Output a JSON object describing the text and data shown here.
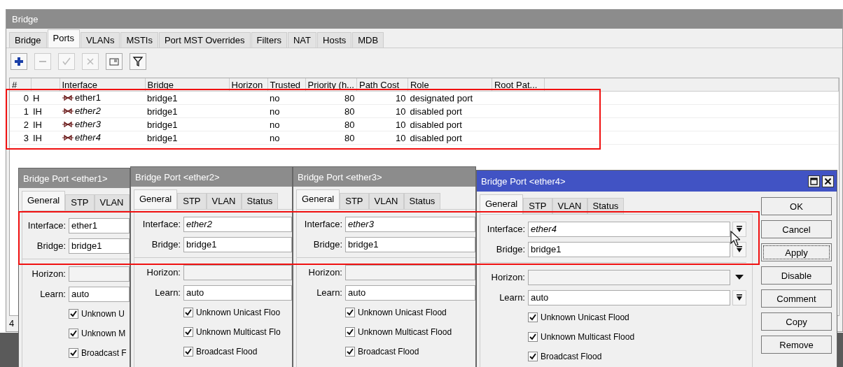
{
  "window": {
    "title": "Bridge"
  },
  "tabs": [
    {
      "label": "Bridge",
      "selected": false
    },
    {
      "label": "Ports",
      "selected": true
    },
    {
      "label": "VLANs",
      "selected": false
    },
    {
      "label": "MSTIs",
      "selected": false
    },
    {
      "label": "Port MST Overrides",
      "selected": false
    },
    {
      "label": "Filters",
      "selected": false
    },
    {
      "label": "NAT",
      "selected": false
    },
    {
      "label": "Hosts",
      "selected": false
    },
    {
      "label": "MDB",
      "selected": false
    }
  ],
  "toolbar": [
    {
      "kind": "add",
      "disabled": false
    },
    {
      "kind": "remove",
      "disabled": true
    },
    {
      "kind": "enable",
      "disabled": true
    },
    {
      "kind": "disable",
      "disabled": true
    },
    {
      "kind": "comment",
      "disabled": false
    },
    {
      "kind": "filter",
      "disabled": false
    }
  ],
  "table": {
    "columns": [
      "#",
      "Interface",
      "Bridge",
      "Horizon",
      "Trusted",
      "Priority (h...",
      "Path Cost",
      "Role",
      "Root Pat..."
    ],
    "rows": [
      {
        "number": "0",
        "flags": "H",
        "interface": "ether1",
        "inactive": false,
        "bridge": "bridge1",
        "trusted": "no",
        "priority": "80",
        "path_cost": "10",
        "role": "designated port"
      },
      {
        "number": "1",
        "flags": "IH",
        "interface": "ether2",
        "inactive": true,
        "bridge": "bridge1",
        "trusted": "no",
        "priority": "80",
        "path_cost": "10",
        "role": "disabled port"
      },
      {
        "number": "2",
        "flags": "IH",
        "interface": "ether3",
        "inactive": true,
        "bridge": "bridge1",
        "trusted": "no",
        "priority": "80",
        "path_cost": "10",
        "role": "disabled port"
      },
      {
        "number": "3",
        "flags": "IH",
        "interface": "ether4",
        "inactive": true,
        "bridge": "bridge1",
        "trusted": "no",
        "priority": "80",
        "path_cost": "10",
        "role": "disabled port"
      }
    ]
  },
  "status_bar": {
    "count": "4"
  },
  "dialogs": [
    {
      "title": "Bridge Port <ether1>",
      "active": false,
      "tabs": [
        {
          "label": "General",
          "selected": true
        },
        {
          "label": "STP",
          "selected": false
        },
        {
          "label": "VLAN",
          "selected": false
        }
      ],
      "fields": [
        {
          "label": "Interface:",
          "value": "ether1",
          "inactive": false
        },
        {
          "label": "Bridge:",
          "value": "bridge1",
          "inactive": false
        },
        {
          "label": "Horizon:"
        },
        {
          "label": "Learn:",
          "value": "auto",
          "inactive": false
        }
      ],
      "checkboxes": [
        {
          "label": "Unknown U",
          "checked": true
        },
        {
          "label": "Unknown M",
          "checked": true
        },
        {
          "label": "Broadcast F",
          "checked": true
        }
      ]
    },
    {
      "title": "Bridge Port <ether2>",
      "active": false,
      "tabs": [
        {
          "label": "General",
          "selected": true
        },
        {
          "label": "STP",
          "selected": false
        },
        {
          "label": "VLAN",
          "selected": false
        },
        {
          "label": "Status",
          "selected": false
        }
      ],
      "fields": [
        {
          "label": "Interface:",
          "value": "ether2",
          "inactive": true
        },
        {
          "label": "Bridge:",
          "value": "bridge1",
          "inactive": false
        },
        {
          "label": "Horizon:"
        },
        {
          "label": "Learn:",
          "value": "auto",
          "inactive": false
        }
      ],
      "checkboxes": [
        {
          "label": "Unknown Unicast Floo",
          "checked": true
        },
        {
          "label": "Unknown Multicast Flo",
          "checked": true
        },
        {
          "label": "Broadcast Flood",
          "checked": true
        }
      ]
    },
    {
      "title": "Bridge Port <ether3>",
      "active": false,
      "tabs": [
        {
          "label": "General",
          "selected": true
        },
        {
          "label": "STP",
          "selected": false
        },
        {
          "label": "VLAN",
          "selected": false
        },
        {
          "label": "Status",
          "selected": false
        }
      ],
      "fields": [
        {
          "label": "Interface:",
          "value": "ether3",
          "inactive": true
        },
        {
          "label": "Bridge:",
          "value": "bridge1",
          "inactive": false
        },
        {
          "label": "Horizon:"
        },
        {
          "label": "Learn:",
          "value": "auto",
          "inactive": false
        }
      ],
      "checkboxes": [
        {
          "label": "Unknown Unicast Flood",
          "checked": true
        },
        {
          "label": "Unknown Multicast Flood",
          "checked": true
        },
        {
          "label": "Broadcast Flood",
          "checked": true
        }
      ]
    },
    {
      "title": "Bridge Port <ether4>",
      "active": true,
      "tabs": [
        {
          "label": "General",
          "selected": true
        },
        {
          "label": "STP",
          "selected": false
        },
        {
          "label": "VLAN",
          "selected": false
        },
        {
          "label": "Status",
          "selected": false
        }
      ],
      "fields": [
        {
          "label": "Interface:",
          "value": "ether4",
          "inactive": true,
          "kind": "select"
        },
        {
          "label": "Bridge:",
          "value": "bridge1",
          "inactive": false,
          "kind": "select"
        },
        {
          "label": "Horizon:",
          "kind": "combo"
        },
        {
          "label": "Learn:",
          "value": "auto",
          "inactive": false,
          "kind": "select"
        }
      ],
      "checkboxes": [
        {
          "label": "Unknown Unicast Flood",
          "checked": true
        },
        {
          "label": "Unknown Multicast Flood",
          "checked": true
        },
        {
          "label": "Broadcast Flood",
          "checked": true
        }
      ],
      "buttons": [
        {
          "label": "OK",
          "focused": false
        },
        {
          "label": "Cancel",
          "focused": false
        },
        {
          "label": "Apply",
          "focused": true
        },
        {
          "label": "Disable",
          "focused": false
        },
        {
          "label": "Comment",
          "focused": false
        },
        {
          "label": "Copy",
          "focused": false
        },
        {
          "label": "Remove",
          "focused": false
        }
      ]
    }
  ]
}
